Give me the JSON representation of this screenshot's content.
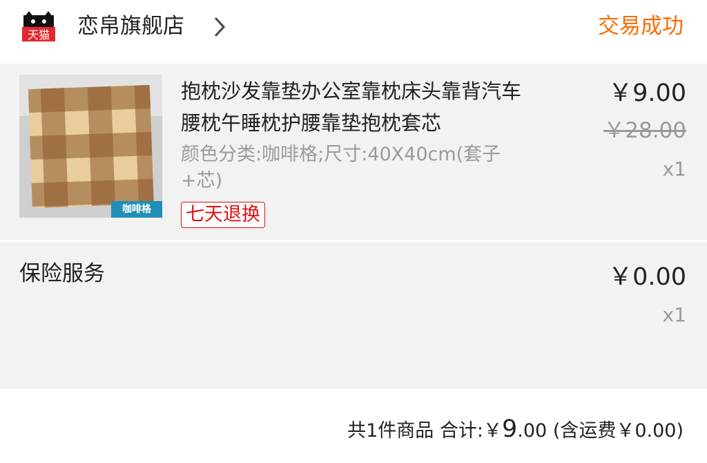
{
  "header": {
    "logo_text": "天猫",
    "store_name": "恋帛旗舰店",
    "status": "交易成功"
  },
  "item": {
    "thumb_label": "咖啡格",
    "title": "抱枕沙发靠垫办公室靠枕床头靠背汽车腰枕午睡枕护腰靠垫抱枕套芯",
    "sku": "颜色分类:咖啡格;尺寸:40X40cm(套子+芯)",
    "badge": "七天退换",
    "price": "￥9.00",
    "original_price": "￥28.00",
    "quantity": "x1"
  },
  "insurance": {
    "label": "保险服务",
    "price": "￥0.00",
    "quantity": "x1"
  },
  "summary": {
    "count_text": "共1件商品",
    "total_label": "合计:",
    "currency": "￥",
    "total_int": "9",
    "total_dec": ".00",
    "shipping_text": "(含运费￥0.00)"
  },
  "colors": {
    "status_orange": "#ff6a00",
    "badge_red": "#dd1111",
    "tmall_red": "#e4262d",
    "card_bg": "#f2f2f2"
  },
  "icons": {
    "logo": "tmall-cat-logo",
    "chevron": "chevron-right-icon"
  }
}
